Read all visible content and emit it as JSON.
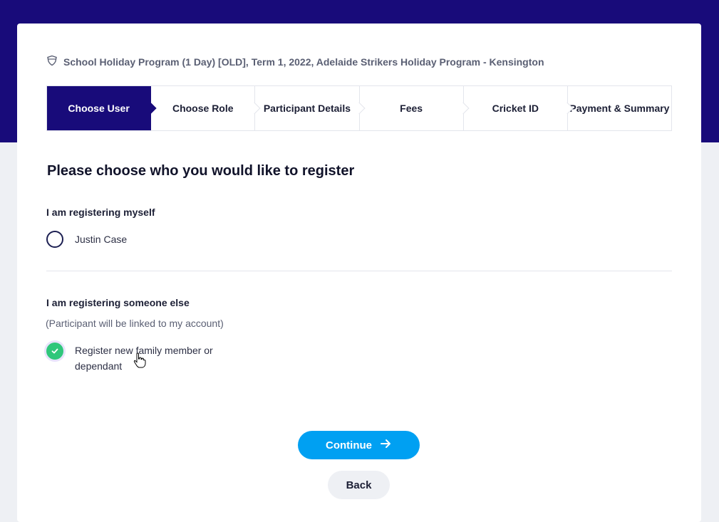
{
  "program": {
    "icon": "shield-icon",
    "title": "School Holiday Program (1 Day) [OLD], Term 1, 2022, Adelaide Strikers Holiday Program - Kensington"
  },
  "steps": [
    {
      "label": "Choose User",
      "active": true
    },
    {
      "label": "Choose Role",
      "active": false
    },
    {
      "label": "Participant Details",
      "active": false
    },
    {
      "label": "Fees",
      "active": false
    },
    {
      "label": "Cricket ID",
      "active": false
    },
    {
      "label": "Payment & Summary",
      "active": false
    }
  ],
  "main": {
    "heading": "Please choose who you would like to register",
    "self_section": {
      "label": "I am registering myself",
      "option": {
        "label": "Justin Case",
        "checked": false
      }
    },
    "other_section": {
      "label": "I am registering someone else",
      "hint": "(Participant will be linked to my account)",
      "option": {
        "label_line1": "Register new family member or",
        "label_line2": "dependant",
        "checked": true
      }
    }
  },
  "actions": {
    "continue_label": "Continue",
    "back_label": "Back"
  },
  "colors": {
    "brand_navy": "#180b7a",
    "accent_blue": "#00a0f2",
    "check_green": "#2fc77b"
  }
}
